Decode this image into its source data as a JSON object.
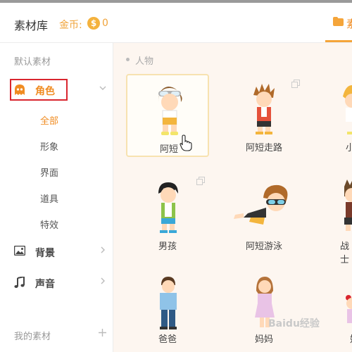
{
  "header": {
    "app_title": "素材库",
    "coin_label": "金币:",
    "coin_symbol": "$",
    "coin_count": "0",
    "folder_tab_label": "素"
  },
  "sidebar": {
    "default_caption": "默认素材",
    "categories": [
      {
        "label": "角色",
        "icon": "ghost-icon",
        "active": true
      },
      {
        "label": "背景",
        "icon": "image-icon"
      },
      {
        "label": "声音",
        "icon": "music-note-icon"
      }
    ],
    "sub_items": [
      "全部",
      "形象",
      "界面",
      "道具",
      "特效"
    ],
    "my_caption": "我的素材"
  },
  "content": {
    "section_label": "人物",
    "cards": [
      {
        "label": "阿短"
      },
      {
        "label": "阿短走路"
      },
      {
        "label": "小"
      },
      {
        "label": "男孩"
      },
      {
        "label": "阿短游泳"
      },
      {
        "label": "战士"
      },
      {
        "label": "爸爸"
      },
      {
        "label": "妈妈"
      },
      {
        "label": "妹"
      }
    ],
    "watermark": "Baidu经验"
  },
  "colors": {
    "accent": "#f08c22",
    "coin": "#f4b23d",
    "highlight_box": "#d9262f",
    "content_bg": "#fdf6f0"
  }
}
